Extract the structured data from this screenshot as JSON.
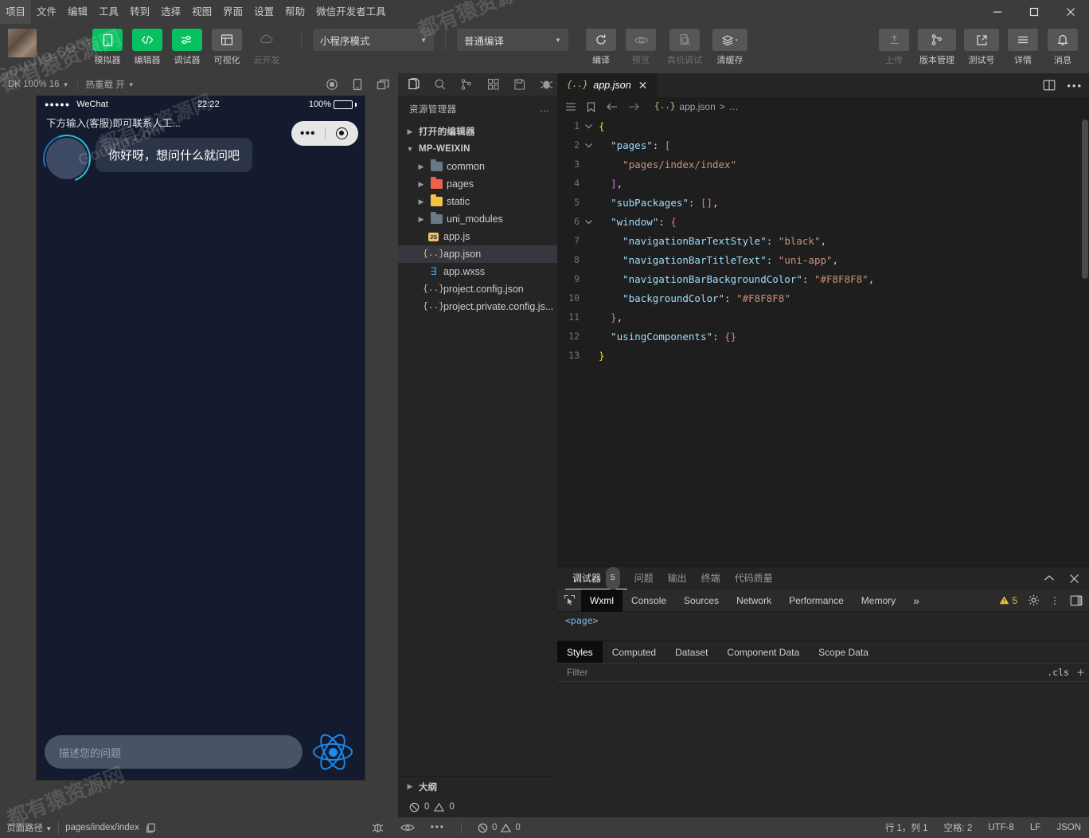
{
  "menubar": {
    "items": [
      "项目",
      "文件",
      "编辑",
      "工具",
      "转到",
      "选择",
      "视图",
      "界面",
      "设置",
      "帮助",
      "微信开发者工具"
    ],
    "window_controls": {
      "minimize": "—",
      "maximize": "▢",
      "close": "✕"
    }
  },
  "toolbar": {
    "buttons": [
      {
        "label": "模拟器",
        "icon": "phone-icon",
        "style": "green"
      },
      {
        "label": "编辑器",
        "icon": "code-icon",
        "style": "green"
      },
      {
        "label": "调试器",
        "icon": "sliders-icon",
        "style": "green"
      },
      {
        "label": "可视化",
        "icon": "layout-icon",
        "style": "grey"
      },
      {
        "label": "云开发",
        "icon": "cloud-icon",
        "style": "disabled"
      }
    ],
    "mode_select": "小程序模式",
    "compile_select": "普通编译",
    "actions": [
      {
        "label": "编译",
        "icon": "refresh-icon",
        "disabled": false
      },
      {
        "label": "预览",
        "icon": "eye-icon",
        "disabled": true
      },
      {
        "label": "真机调试",
        "icon": "device-debug-icon",
        "disabled": true
      },
      {
        "label": "清缓存",
        "icon": "layers-icon",
        "disabled": false
      }
    ],
    "right_actions": [
      {
        "label": "上传",
        "icon": "upload-icon",
        "disabled": true
      },
      {
        "label": "版本管理",
        "icon": "branch-icon",
        "disabled": false
      },
      {
        "label": "测试号",
        "icon": "external-link-icon",
        "disabled": false
      },
      {
        "label": "详情",
        "icon": "hamburger-icon",
        "disabled": false
      },
      {
        "label": "消息",
        "icon": "bell-icon",
        "disabled": false
      }
    ]
  },
  "simulator": {
    "bar": {
      "sdk_label": "DK 100% 16",
      "hotreload_label": "热重载 开"
    },
    "status": {
      "carrier": "WeChat",
      "signal_dots": "●●●●●",
      "time": "22:22",
      "battery": "100%"
    },
    "subtitle": "下方输入(客服)即可联系人工...",
    "capsule": {
      "more": "•••",
      "target": "target-icon"
    },
    "message": "你好呀，想问什么就问吧",
    "composer_placeholder": "描述您的问题"
  },
  "explorer": {
    "activity_icons": [
      "files-icon",
      "search-icon",
      "source-control-icon",
      "extensions-icon",
      "save-all-icon",
      "debug-icon"
    ],
    "title": "资源管理器",
    "more": "…",
    "tree": [
      {
        "label": "打开的编辑器",
        "type": "section",
        "expanded": false,
        "indent": 0
      },
      {
        "label": "MP-WEIXIN",
        "type": "root",
        "expanded": true,
        "indent": 0
      },
      {
        "label": "common",
        "type": "folder",
        "color": "#6b7885",
        "indent": 1
      },
      {
        "label": "pages",
        "type": "folder",
        "color": "#f0604d",
        "indent": 1
      },
      {
        "label": "static",
        "type": "folder",
        "color": "#f3c246",
        "indent": 1
      },
      {
        "label": "uni_modules",
        "type": "folder",
        "color": "#6b7885",
        "indent": 1
      },
      {
        "label": "app.js",
        "type": "js",
        "indent": 1
      },
      {
        "label": "app.json",
        "type": "json",
        "indent": 1,
        "selected": true
      },
      {
        "label": "app.wxss",
        "type": "css",
        "indent": 1
      },
      {
        "label": "project.config.json",
        "type": "json",
        "indent": 1
      },
      {
        "label": "project.private.config.js...",
        "type": "json",
        "indent": 1
      }
    ],
    "outline_label": "大纲",
    "status": {
      "errors": "0",
      "warnings": "0"
    }
  },
  "editor": {
    "tab": {
      "label": "app.json",
      "icon": "json-icon",
      "close": "✕"
    },
    "right_icons": [
      "split-editor-icon",
      "more-actions-icon"
    ],
    "breadcrumb": {
      "path": "app.json",
      "suffix": "…"
    },
    "lines": [
      {
        "n": "1",
        "fold": "v",
        "html": "<span class='b'>{</span>"
      },
      {
        "n": "2",
        "fold": "v",
        "html": "  <span class='k'>\"pages\"</span><span class='p'>: </span><span class='b2'>[</span>"
      },
      {
        "n": "3",
        "fold": "",
        "html": "    <span class='s'>\"pages/index/index\"</span>"
      },
      {
        "n": "4",
        "fold": "",
        "html": "  <span class='b2'>]</span><span class='p'>,</span>"
      },
      {
        "n": "5",
        "fold": "",
        "html": "  <span class='k'>\"subPackages\"</span><span class='p'>: </span><span class='b2'>[]</span><span class='p'>,</span>"
      },
      {
        "n": "6",
        "fold": "v",
        "html": "  <span class='k'>\"window\"</span><span class='p'>: </span><span class='b2'>{</span>"
      },
      {
        "n": "7",
        "fold": "",
        "html": "    <span class='k'>\"navigationBarTextStyle\"</span><span class='p'>: </span><span class='s'>\"black\"</span><span class='p'>,</span>"
      },
      {
        "n": "8",
        "fold": "",
        "html": "    <span class='k'>\"navigationBarTitleText\"</span><span class='p'>: </span><span class='s'>\"uni-app\"</span><span class='p'>,</span>"
      },
      {
        "n": "9",
        "fold": "",
        "html": "    <span class='k'>\"navigationBarBackgroundColor\"</span><span class='p'>: </span><span class='s'>\"#F8F8F8\"</span><span class='p'>,</span>"
      },
      {
        "n": "10",
        "fold": "",
        "html": "    <span class='k'>\"backgroundColor\"</span><span class='p'>: </span><span class='s'>\"#F8F8F8\"</span>"
      },
      {
        "n": "11",
        "fold": "",
        "html": "  <span class='b2'>}</span><span class='p'>,</span>"
      },
      {
        "n": "12",
        "fold": "",
        "html": "  <span class='k'>\"usingComponents\"</span><span class='p'>: </span><span class='b2'>{}</span>"
      },
      {
        "n": "13",
        "fold": "",
        "html": "<span class='b'>}</span>"
      }
    ]
  },
  "devtools": {
    "tabs": [
      {
        "label": "调试器",
        "badge": "5",
        "active": true
      },
      {
        "label": "问题",
        "badge": "",
        "active": false
      },
      {
        "label": "输出",
        "badge": "",
        "active": false
      },
      {
        "label": "终端",
        "badge": "",
        "active": false
      },
      {
        "label": "代码质量",
        "badge": "",
        "active": false
      }
    ],
    "collapse_icon": "chevron-up-icon",
    "close_icon": "close-icon",
    "panels": [
      "Wxml",
      "Console",
      "Sources",
      "Network",
      "Performance",
      "Memory"
    ],
    "panels_overflow": "»",
    "active_panel": "Wxml",
    "warning_count": "5",
    "dom_snippet": "<page>",
    "sub_panels": [
      "Styles",
      "Computed",
      "Dataset",
      "Component Data",
      "Scope Data"
    ],
    "active_sub_panel": "Styles",
    "filter_placeholder": "Filter",
    "cls_label": ".cls",
    "add_label": "+"
  },
  "statusbar": {
    "page_path_label": "页面路径",
    "page_path_value": "pages/index/index",
    "copy_icon": "copy-icon",
    "mid_icons": [
      "bug-icon",
      "eye-icon",
      "more-icon"
    ],
    "problems": {
      "errors": "0",
      "warnings": "0"
    },
    "right": [
      "行 1，列 1",
      "空格: 2",
      "UTF-8",
      "LF",
      "JSON"
    ]
  },
  "watermarks": [
    "Gouvip.com",
    "都有猿资源网"
  ]
}
